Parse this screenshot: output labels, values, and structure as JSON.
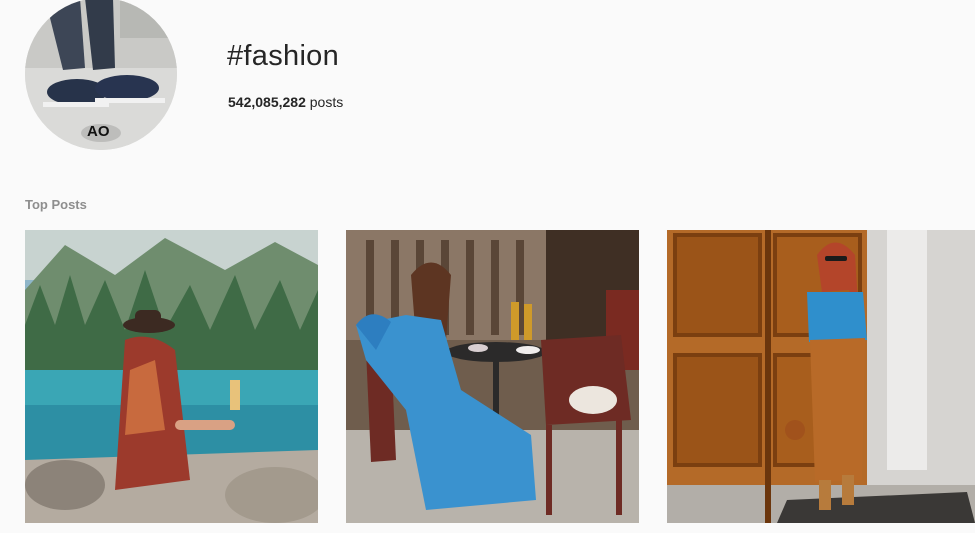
{
  "hashtag": {
    "title": "#fashion",
    "post_count": "542,085,282",
    "post_count_suffix": " posts"
  },
  "avatar": {
    "logo_text": "AO"
  },
  "sections": {
    "top_posts_label": "Top Posts"
  },
  "posts": [
    {
      "scene": "woman-seated-by-mountain-lake"
    },
    {
      "scene": "woman-in-blue-dress-at-cafe-table"
    },
    {
      "scene": "woman-in-blue-top-and-tan-skirt-by-wooden-door"
    }
  ]
}
